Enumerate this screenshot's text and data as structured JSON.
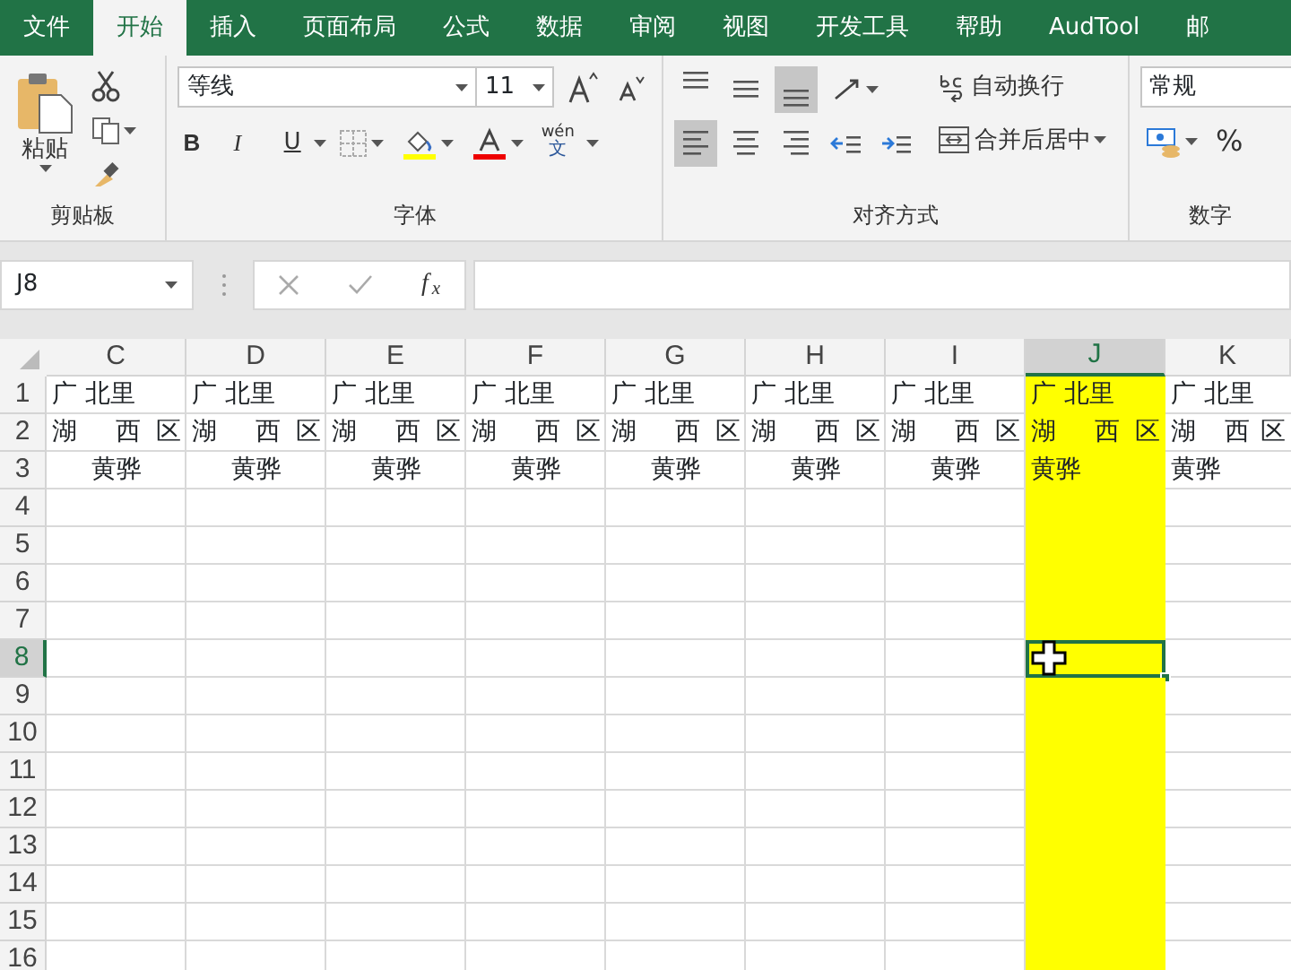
{
  "tabs": [
    {
      "label": "文件",
      "selected": false
    },
    {
      "label": "开始",
      "selected": true
    },
    {
      "label": "插入",
      "selected": false
    },
    {
      "label": "页面布局",
      "selected": false
    },
    {
      "label": "公式",
      "selected": false
    },
    {
      "label": "数据",
      "selected": false
    },
    {
      "label": "审阅",
      "selected": false
    },
    {
      "label": "视图",
      "selected": false
    },
    {
      "label": "开发工具",
      "selected": false
    },
    {
      "label": "帮助",
      "selected": false
    },
    {
      "label": "AudTool",
      "selected": false
    },
    {
      "label": "邮",
      "selected": false
    }
  ],
  "clipboard": {
    "paste_label": "粘贴",
    "group_label": "剪贴板"
  },
  "font": {
    "font_name": "等线",
    "font_size": "11",
    "bold": "B",
    "italic": "I",
    "underline": "U",
    "phonetic_top": "wén",
    "phonetic_bottom": "文",
    "group_label": "字体"
  },
  "alignment": {
    "vertical": [
      {
        "selected": false
      },
      {
        "selected": false
      },
      {
        "selected": true
      }
    ],
    "horizontal": [
      {
        "selected": true
      },
      {
        "selected": false
      },
      {
        "selected": false
      }
    ],
    "wrap_text": "自动换行",
    "merge": "合并后居中",
    "group_label": "对齐方式"
  },
  "number": {
    "format": "常规",
    "percent": "%",
    "group_label": "数字"
  },
  "formula_bar": {
    "name_box": "J8",
    "fx": "f$_{x}$"
  },
  "columns": [
    {
      "label": "C",
      "selected": false
    },
    {
      "label": "D",
      "selected": false
    },
    {
      "label": "E",
      "selected": false
    },
    {
      "label": "F",
      "selected": false
    },
    {
      "label": "G",
      "selected": false
    },
    {
      "label": "H",
      "selected": false
    },
    {
      "label": "I",
      "selected": false
    },
    {
      "label": "J",
      "selected": true,
      "color": "#ffff00"
    },
    {
      "label": "K",
      "selected": false
    }
  ],
  "rows": [
    {
      "label": "1",
      "selected": false,
      "kind": "left",
      "cells": [
        "广 北里",
        "广 北里",
        "广 北里",
        "广 北里",
        "广 北里",
        "广 北里",
        "广 北里",
        "广 北里",
        "广 北里"
      ]
    },
    {
      "label": "2",
      "selected": false,
      "kind": "justify",
      "cells": [
        "湖 西区",
        "湖 西区",
        "湖 西区",
        "湖 西区",
        "湖 西区",
        "湖 西区",
        "湖 西区",
        "湖 西区",
        "湖 西区"
      ]
    },
    {
      "label": "3",
      "selected": false,
      "kind": "center",
      "cells": [
        "黄骅",
        "黄骅",
        "黄骅",
        "黄骅",
        "黄骅",
        "黄骅",
        "黄骅",
        {
          "text": "黄骅",
          "kind": "left"
        },
        {
          "text": "黄骅",
          "kind": "left"
        }
      ]
    },
    {
      "label": "4",
      "selected": false
    },
    {
      "label": "5",
      "selected": false
    },
    {
      "label": "6",
      "selected": false
    },
    {
      "label": "7",
      "selected": false
    },
    {
      "label": "8",
      "selected": true
    },
    {
      "label": "9",
      "selected": false
    },
    {
      "label": "10",
      "selected": false
    },
    {
      "label": "11",
      "selected": false
    },
    {
      "label": "12",
      "selected": false
    },
    {
      "label": "13",
      "selected": false
    },
    {
      "label": "14",
      "selected": false
    },
    {
      "label": "15",
      "selected": false
    },
    {
      "label": "16",
      "selected": false
    }
  ]
}
